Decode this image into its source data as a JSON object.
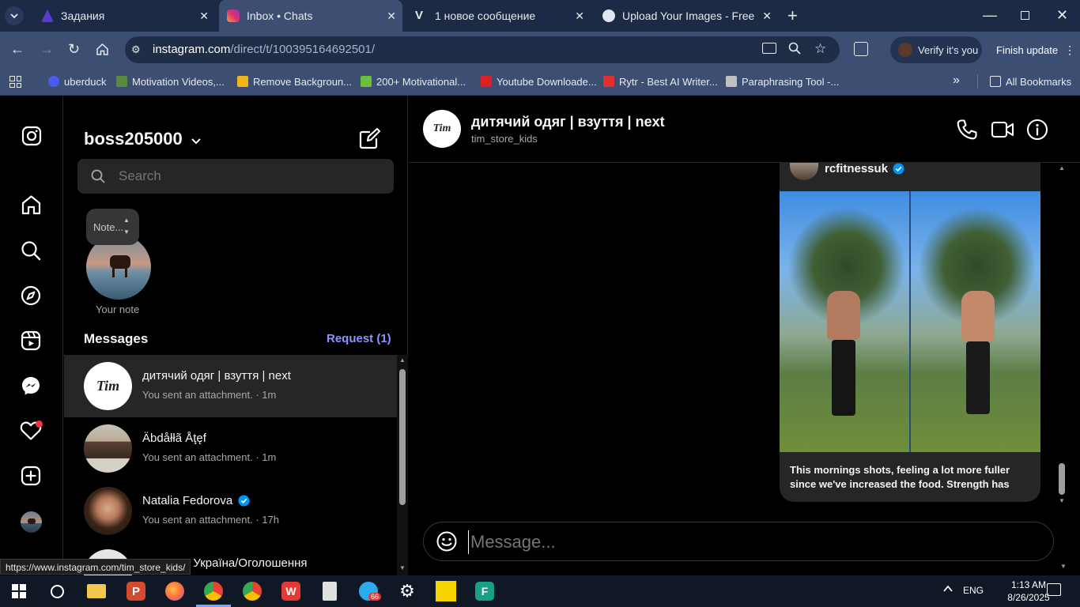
{
  "browser": {
    "tabs": [
      {
        "title": "Задания",
        "active": false
      },
      {
        "title": "Inbox • Chats",
        "active": true
      },
      {
        "title": "1 новое сообщение",
        "active": false
      },
      {
        "title": "Upload Your Images - Free Imag",
        "active": false
      }
    ],
    "url_host": "instagram.com",
    "url_path": "/direct/t/100395164692501/",
    "verify_label": "Verify it's you",
    "finish_update_label": "Finish update",
    "bookmarks": [
      {
        "label": "uberduck",
        "color": "#4a5cf0"
      },
      {
        "label": "Motivation Videos,...",
        "color": "#5a8a3c"
      },
      {
        "label": "Remove Backgroun...",
        "color": "#f2b51a"
      },
      {
        "label": "200+ Motivational...",
        "color": "#6bbf3a"
      },
      {
        "label": "Youtube Downloade...",
        "color": "#e02020"
      },
      {
        "label": "Rytr - Best AI Writer...",
        "color": "#e03030"
      },
      {
        "label": "Paraphrasing Tool -...",
        "color": "#c0c0c0"
      }
    ],
    "all_bookmarks_label": "All Bookmarks",
    "status_url": "https://www.instagram.com/tim_store_kids/"
  },
  "inbox": {
    "username": "boss205000",
    "search_placeholder": "Search",
    "note_bubble": "Note...",
    "note_label": "Your note",
    "messages_heading": "Messages",
    "request_label": "Request (1)",
    "threads": [
      {
        "name": "дитячий одяг | взуття | next",
        "preview": "You sent an attachment. · 1m",
        "selected": true
      },
      {
        "name": "Äbdåłłã Åţęf",
        "preview": "You sent an attachment. · 1m",
        "selected": false
      },
      {
        "name": "Natalia Fedorova",
        "preview": "You sent an attachment. · 17h",
        "verified": true,
        "selected": false
      },
      {
        "name": "Реклама Україна/Оголошення",
        "preview": "",
        "selected": false
      }
    ]
  },
  "chat": {
    "title": "дитячий одяг | взуття | next",
    "subtitle": "tim_store_kids",
    "shared_post": {
      "author": "rcfitnessuk",
      "verified": true,
      "caption": "This mornings shots, feeling a lot more fuller since we've increased the food. Strength has been on..."
    },
    "composer_placeholder": "Message..."
  },
  "avatar_logo_text": "Tim",
  "taskbar": {
    "language": "ENG",
    "time": "1:13 AM",
    "date": "8/26/2025",
    "telegram_badge": "66"
  },
  "colors": {
    "link_blue": "#8f93ff",
    "verified_blue": "#0095f6",
    "notification_red": "#ff3040"
  }
}
